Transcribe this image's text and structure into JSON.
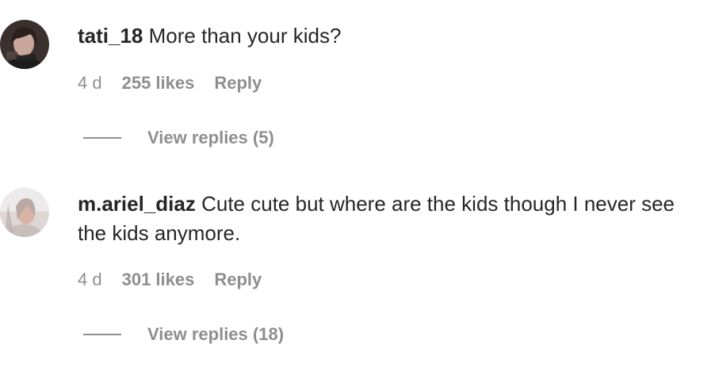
{
  "comments": [
    {
      "username": "tati_18",
      "text": "More than your kids?",
      "time": "4 d",
      "likes": "255 likes",
      "reply_label": "Reply",
      "view_replies_label": "View replies (5)"
    },
    {
      "username": "m.ariel_diaz",
      "text": "Cute cute but where are the kids though I never see the kids anymore.",
      "time": "4 d",
      "likes": "301 likes",
      "reply_label": "Reply",
      "view_replies_label": "View replies (18)"
    }
  ],
  "colors": {
    "text": "#262626",
    "secondary": "#8e8e8e"
  }
}
